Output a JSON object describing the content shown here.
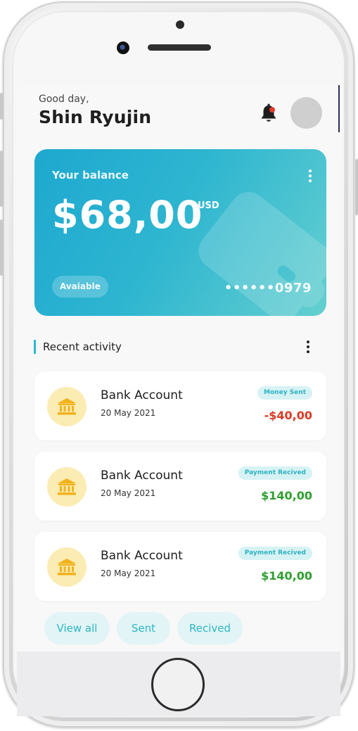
{
  "header": {
    "greeting": "Good day,",
    "user_name": "Shin Ryujin"
  },
  "balance_card": {
    "label": "Your balance",
    "amount": "$68,00",
    "currency": "USD",
    "status": "Avaiable",
    "card_number": "••••••0979"
  },
  "recent_activity": {
    "title": "Recent activity",
    "items": [
      {
        "title": "Bank Account",
        "date": "20 May 2021",
        "badge": "Money Sent",
        "amount": "-$40,00",
        "amount_color": "#d93a23"
      },
      {
        "title": "Bank Account",
        "date": "20 May 2021",
        "badge": "Payment Recived",
        "amount": "$140,00",
        "amount_color": "#2f9e2f"
      },
      {
        "title": "Bank Account",
        "date": "20 May 2021",
        "badge": "Payment Recived",
        "amount": "$140,00",
        "amount_color": "#2f9e2f"
      }
    ]
  },
  "filters": {
    "view_all": "View all",
    "sent": "Sent",
    "received": "Recived"
  },
  "colors": {
    "accent": "#2db7c6",
    "negative": "#d93a23",
    "positive": "#2f9e2f",
    "notification_dot": "#e03a2c"
  },
  "icons": [
    "bell-icon",
    "more-vertical-icon",
    "bank-icon",
    "wallet-icon"
  ]
}
